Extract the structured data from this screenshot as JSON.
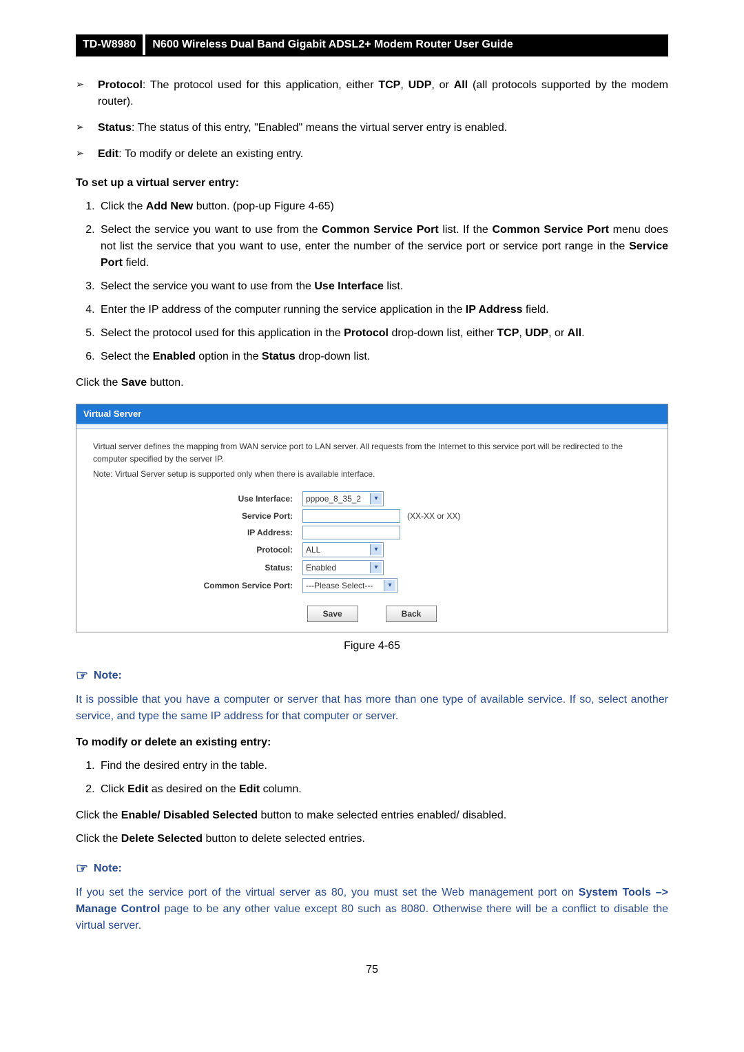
{
  "header": {
    "model": "TD-W8980",
    "title": "N600 Wireless Dual Band Gigabit ADSL2+ Modem Router User Guide"
  },
  "bullets": {
    "b1_pre": "Protocol",
    "b1_rest_a": ": The protocol used for this application, either ",
    "b1_tcp": "TCP",
    "b1_c1": ", ",
    "b1_udp": "UDP",
    "b1_c2": ", or ",
    "b1_all": "All",
    "b1_rest_b": " (all protocols supported by the modem router).",
    "b2_pre": "Status",
    "b2_rest": ": The status of this entry, \"Enabled\" means the virtual server entry is enabled.",
    "b3_pre": "Edit",
    "b3_rest": ": To modify or delete an existing entry."
  },
  "sec1_title": "To set up a virtual server entry:",
  "ol1": {
    "i1_a": "Click the ",
    "i1_b": "Add New",
    "i1_c": " button. (pop-up Figure 4-65)",
    "i2_a": "Select the service you want to use from the ",
    "i2_b": "Common Service Port",
    "i2_c": " list. If the ",
    "i2_d": "Common Service Port",
    "i2_e": " menu does not list the service that you want to use, enter the number of the service port or service port range in the ",
    "i2_f": "Service Port",
    "i2_g": " field.",
    "i3_a": "Select the service you want to use from the ",
    "i3_b": "Use Interface",
    "i3_c": " list.",
    "i4_a": "Enter the IP address of the computer running the service application in the ",
    "i4_b": "IP Address",
    "i4_c": " field.",
    "i5_a": "Select the protocol used for this application in the ",
    "i5_b": "Protocol",
    "i5_c": " drop-down list, either ",
    "i5_d": "TCP",
    "i5_e": ", ",
    "i5_f": "UDP",
    "i5_g": ", or ",
    "i5_h": "All",
    "i5_i": ".",
    "i6_a": "Select the ",
    "i6_b": "Enabled",
    "i6_c": " option in the ",
    "i6_d": "Status",
    "i6_e": " drop-down list."
  },
  "after_ol1_a": "Click the ",
  "after_ol1_b": "Save",
  "after_ol1_c": " button.",
  "screenshot": {
    "title": "Virtual Server",
    "desc": "Virtual server defines the mapping from WAN service port to LAN server. All requests from the Internet to this service port will be redirected to the computer specified by the server IP.",
    "note": "Note: Virtual Server setup is supported only when there is available interface.",
    "labels": {
      "use_interface": "Use Interface:",
      "service_port": "Service Port:",
      "ip_address": "IP Address:",
      "protocol": "Protocol:",
      "status": "Status:",
      "common_service_port": "Common Service Port:"
    },
    "values": {
      "use_interface": "pppoe_8_35_2",
      "service_port_hint": "(XX-XX or XX)",
      "protocol": "ALL",
      "status": "Enabled",
      "common_service_port": "---Please Select---"
    },
    "buttons": {
      "save": "Save",
      "back": "Back"
    }
  },
  "fig_caption": "Figure 4-65",
  "note_label": "Note:",
  "note1_body": "It is possible that you have a computer or server that has more than one type of available service. If so, select another service, and type the same IP address for that computer or server.",
  "sec2_title": "To modify or delete an existing entry:",
  "ol2": {
    "i1": "Find the desired entry in the table.",
    "i2_a": "Click ",
    "i2_b": "Edit",
    "i2_c": " as desired on the ",
    "i2_d": "Edit",
    "i2_e": " column."
  },
  "p2_a": "Click the ",
  "p2_b": "Enable/ Disabled Selected",
  "p2_c": " button to make selected entries enabled/ disabled.",
  "p3_a": "Click the ",
  "p3_b": "Delete Selected",
  "p3_c": " button to delete selected entries.",
  "note2_a": "If you set the service port of the virtual server as 80, you must set the Web management port on ",
  "note2_b": "System Tools –> Manage Control",
  "note2_c": " page to be any other value except 80 such as 8080. Otherwise there will be a conflict to disable the virtual server.",
  "page_num": "75"
}
